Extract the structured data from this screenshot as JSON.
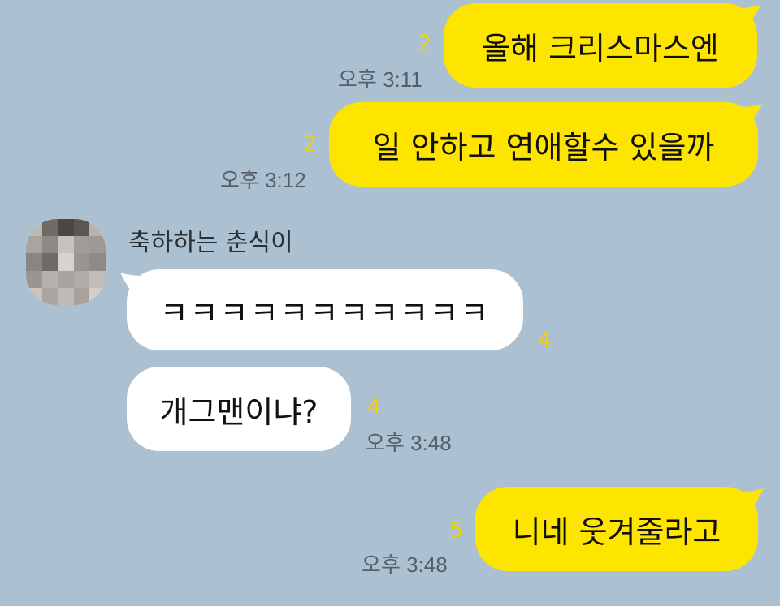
{
  "messages": [
    {
      "id": "m1",
      "side": "me",
      "text": "올해 크리스마스엔",
      "unread": "2",
      "time": "오후 3:11"
    },
    {
      "id": "m2",
      "side": "me",
      "text": "일 안하고 연애할수 있을까",
      "unread": "2",
      "time": "오후 3:12"
    },
    {
      "id": "m3",
      "side": "them",
      "text": "ㅋㅋㅋㅋㅋㅋㅋㅋㅋㅋㅋ",
      "unread": "4",
      "time": ""
    },
    {
      "id": "m4",
      "side": "them",
      "text": "개그맨이냐?",
      "unread": "4",
      "time": "오후 3:48"
    },
    {
      "id": "m5",
      "side": "me",
      "text": "니네 웃겨줄라고",
      "unread": "5",
      "time": "오후 3:48"
    }
  ],
  "sender": {
    "name": "축하하는 춘식이",
    "avatar": "blurred-profile-photo"
  },
  "colors": {
    "background": "#abc1d1",
    "my_bubble": "#fee500",
    "their_bubble": "#ffffff",
    "unread": "#f5d000"
  }
}
